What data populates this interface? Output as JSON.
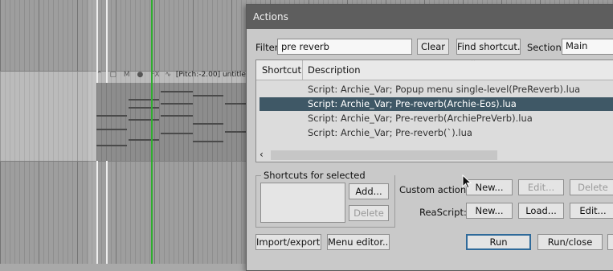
{
  "background": {
    "track_header_text": "[Pitch:-2.00] untitle",
    "track_header_icons": [
      "lock-icon",
      "mute-label",
      "fx-label",
      "envelope-icon"
    ]
  },
  "dialog": {
    "title": "Actions",
    "filter_label": "Filter:",
    "filter_value": "pre reverb",
    "clear_button": "Clear",
    "find_shortcut_button": "Find shortcut...",
    "section_label": "Section:",
    "section_value": "Main",
    "columns": [
      "Shortcut",
      "Description"
    ],
    "rows": [
      {
        "shortcut": "",
        "description": "Script: Archie_Var;  Popup menu single-level(PreReverb).lua",
        "selected": false
      },
      {
        "shortcut": "",
        "description": "Script: Archie_Var;  Pre-reverb(Archie-Eos).lua",
        "selected": true
      },
      {
        "shortcut": "",
        "description": "Script: Archie_Var;  Pre-reverb(ArchiePreVerb).lua",
        "selected": false
      },
      {
        "shortcut": "",
        "description": "Script: Archie_Var;  Pre-reverb(`).lua",
        "selected": false
      }
    ],
    "shortcuts_group_title": "Shortcuts for selected action",
    "add_button": "Add...",
    "delete_shortcut_button": "Delete",
    "custom_actions_label": "Custom actions:",
    "custom_new_button": "New...",
    "custom_edit_button": "Edit...",
    "custom_delete_button": "Delete",
    "reascript_label": "ReaScript:",
    "reascript_new_button": "New...",
    "reascript_load_button": "Load...",
    "reascript_edit_button": "Edit...",
    "import_export_button": "Import/export...",
    "menu_editor_button": "Menu editor...",
    "run_button": "Run",
    "run_close_button": "Run/close"
  },
  "colors": {
    "selection": "#3f5866",
    "titlebar": "#5e5e5e",
    "playhead": "#2fae2f"
  }
}
